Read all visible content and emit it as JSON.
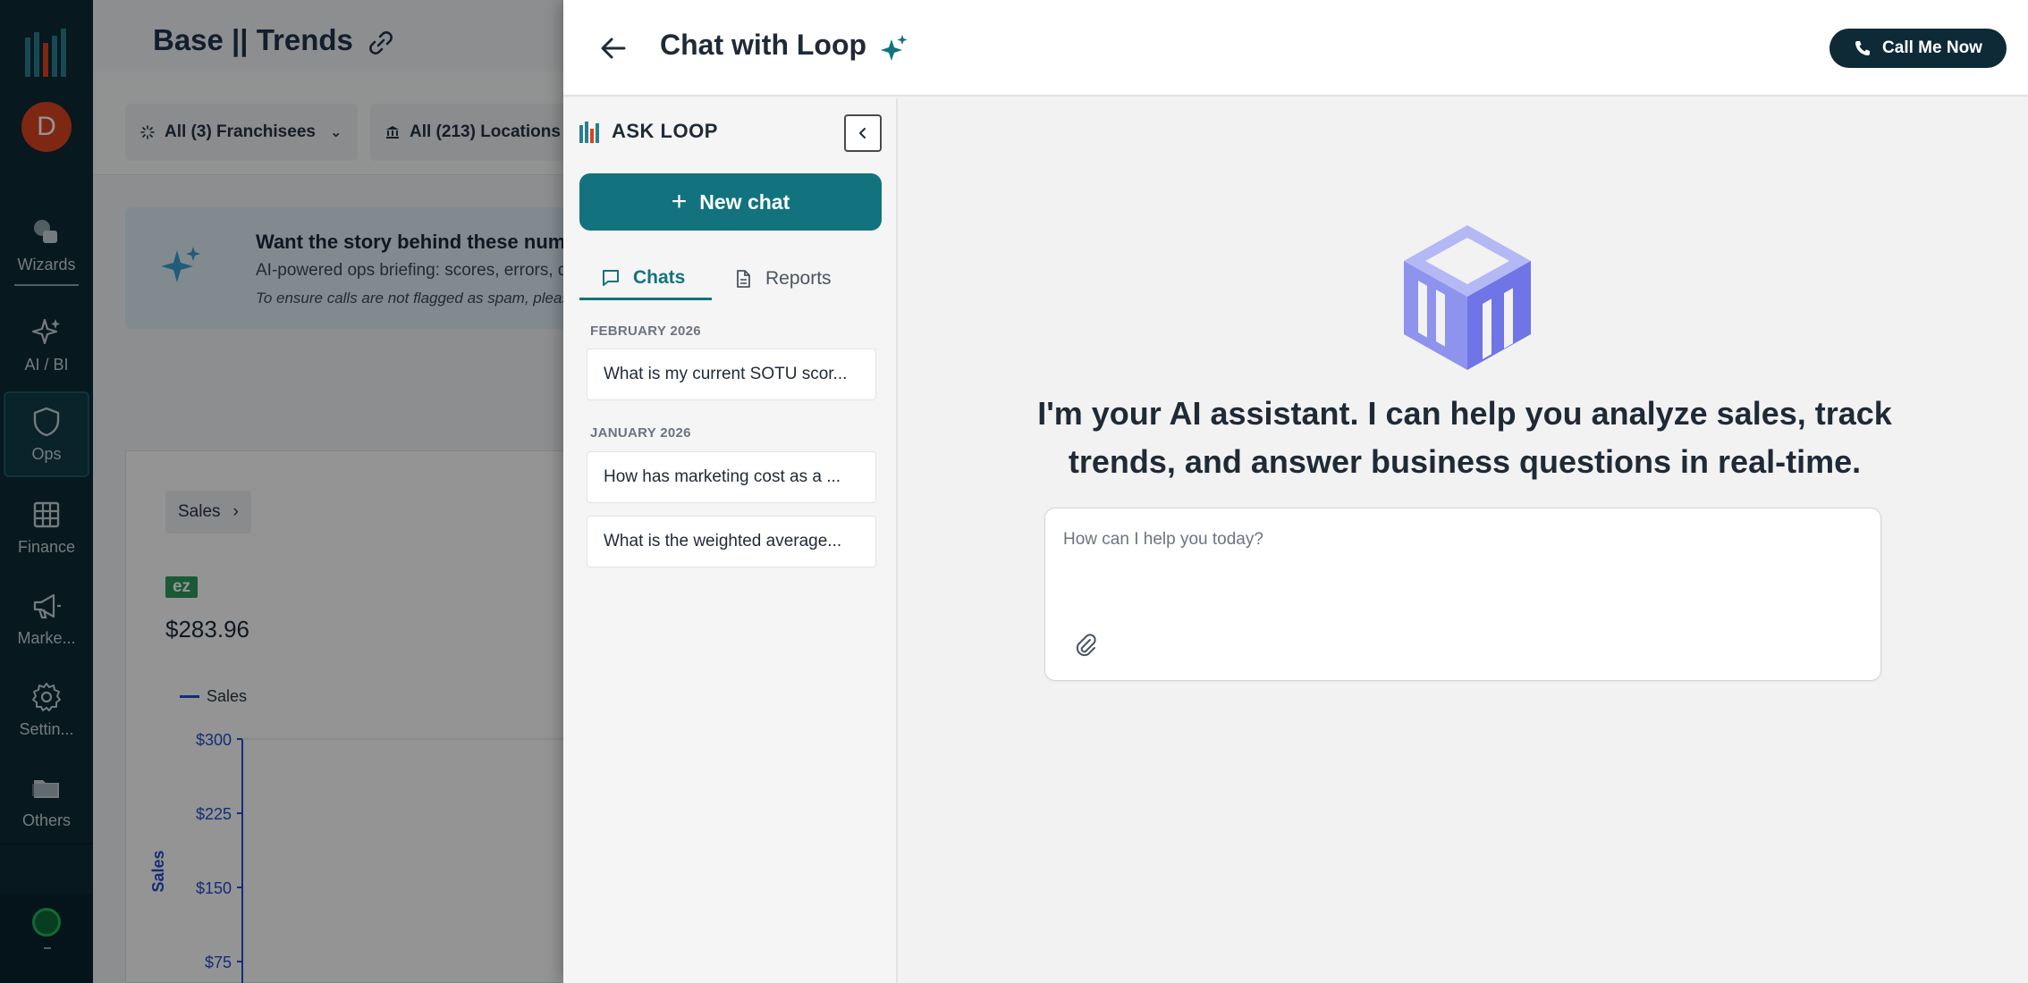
{
  "nav": {
    "avatar_letter": "D",
    "items": [
      {
        "label": "Wizards"
      },
      {
        "label": "AI / BI"
      },
      {
        "label": "Ops"
      },
      {
        "label": "Finance"
      },
      {
        "label": "Marke..."
      },
      {
        "label": "Settin..."
      },
      {
        "label": "Others"
      }
    ],
    "bottom_label": "-"
  },
  "background": {
    "page_title": "Base || Trends",
    "filters": [
      {
        "label": "All (3) Franchisees"
      },
      {
        "label": "All (213) Locations"
      }
    ],
    "banner": {
      "heading": "Want the story behind these numbe",
      "subtext": "AI-powered ops briefing: scores, errors, de",
      "note": "To ensure calls are not flagged as spam, please"
    },
    "card": {
      "breadcrumb": "Sales",
      "badge": "ez",
      "amount": "$283.96",
      "legend": "Sales",
      "y_axis_label": "Sales",
      "y_ticks": [
        "$300",
        "$225",
        "$150",
        "$75"
      ]
    }
  },
  "chat": {
    "title": "Chat with Loop",
    "call_button": "Call Me Now",
    "brand": "ASK LOOP",
    "new_chat": "New chat",
    "tabs": [
      {
        "label": "Chats",
        "active": true
      },
      {
        "label": "Reports",
        "active": false
      }
    ],
    "groups": [
      {
        "month": "FEBRUARY 2026",
        "chats": [
          "What is my current SOTU scor..."
        ]
      },
      {
        "month": "JANUARY 2026",
        "chats": [
          "How has marketing cost as a ...",
          "What is the weighted average..."
        ]
      }
    ],
    "intro": "I'm your AI assistant. I can help you analyze sales, track trends, and answer business questions in real-time.",
    "input_placeholder": "How can I help you today?",
    "input_value": ""
  },
  "colors": {
    "rail_bg": "#0d2a36",
    "accent_teal": "#12737f",
    "call_button_bg": "#0d2a36",
    "avatar_bg": "#d9441f",
    "logo_purple": "#6f74e6"
  }
}
